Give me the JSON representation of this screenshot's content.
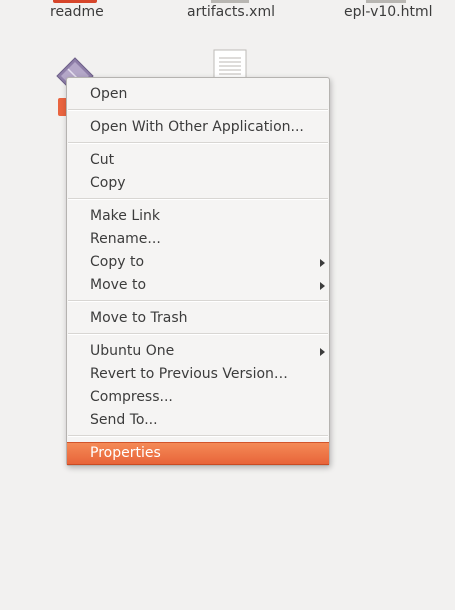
{
  "desktop": {
    "files_top": [
      {
        "name": "readme",
        "icon": "document-red-icon"
      },
      {
        "name": "artifacts.xml",
        "icon": "document-icon"
      },
      {
        "name": "epl-v10.html",
        "icon": "document-icon"
      }
    ],
    "second_row_icons": [
      "archive-icon",
      "text-document-icon"
    ]
  },
  "context_menu": {
    "items": [
      {
        "label": "Open"
      },
      {
        "label": "Open With Other Application..."
      },
      {
        "label": "Cut"
      },
      {
        "label": "Copy"
      },
      {
        "label": "Make Link"
      },
      {
        "label": "Rename..."
      },
      {
        "label": "Copy to",
        "submenu": true
      },
      {
        "label": "Move to",
        "submenu": true
      },
      {
        "label": "Move to Trash"
      },
      {
        "label": "Ubuntu One",
        "submenu": true
      },
      {
        "label": "Revert to Previous Version…"
      },
      {
        "label": "Compress..."
      },
      {
        "label": "Send To..."
      },
      {
        "label": "Properties",
        "selected": true
      }
    ],
    "highlight_color": "#ee7444"
  }
}
